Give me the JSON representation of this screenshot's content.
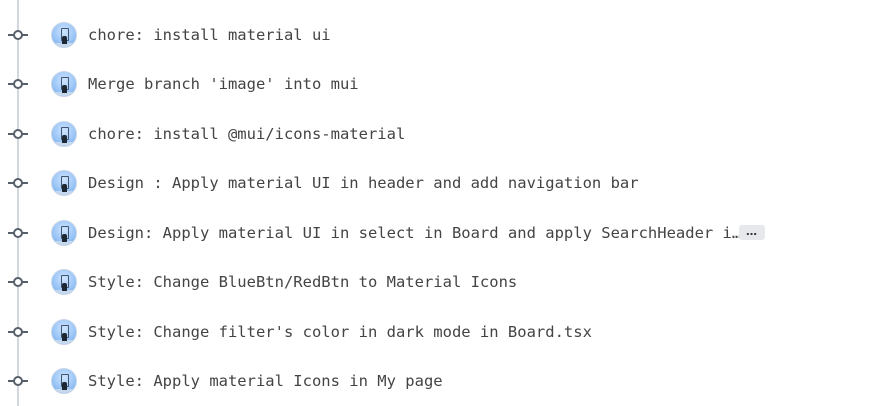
{
  "commits": [
    {
      "message": "chore: install material ui"
    },
    {
      "message": "Merge branch 'image' into mui"
    },
    {
      "message": "chore: install @mui/icons-material"
    },
    {
      "message": "Design : Apply material UI in header and add navigation bar"
    },
    {
      "message": "Design: Apply material UI in select in Board and apply SearchHeader i…",
      "more_label": "…"
    },
    {
      "message": "Style: Change BlueBtn/RedBtn to Material Icons"
    },
    {
      "message": "Style: Change filter's color in dark mode in Board.tsx"
    },
    {
      "message": "Style: Apply material Icons in My page"
    }
  ],
  "icons": {
    "node": "git-commit-icon",
    "avatar": "user-avatar"
  }
}
